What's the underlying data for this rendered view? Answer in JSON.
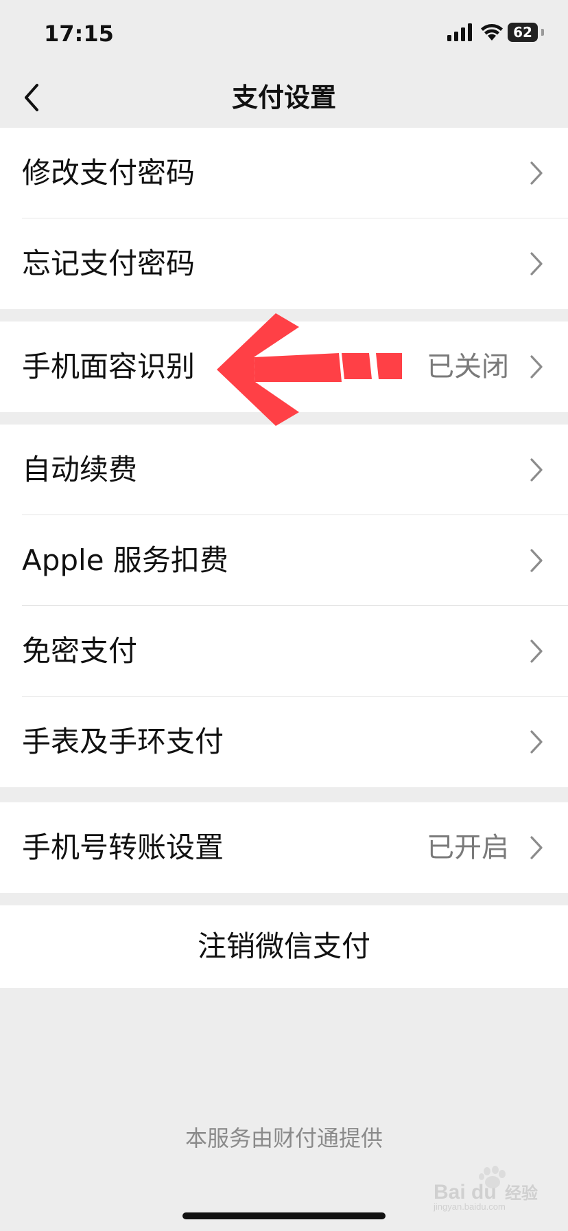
{
  "status_bar": {
    "time": "17:15",
    "battery": "62"
  },
  "nav": {
    "title": "支付设置"
  },
  "groups": [
    {
      "items": [
        {
          "label": "修改支付密码"
        },
        {
          "label": "忘记支付密码"
        }
      ]
    },
    {
      "items": [
        {
          "label": "手机面容识别",
          "value": "已关闭"
        }
      ]
    },
    {
      "items": [
        {
          "label": "自动续费"
        },
        {
          "label": "Apple 服务扣费"
        },
        {
          "label": "免密支付"
        },
        {
          "label": "手表及手环支付"
        }
      ]
    },
    {
      "items": [
        {
          "label": "手机号转账设置",
          "value": "已开启"
        }
      ]
    }
  ],
  "logout": {
    "label": "注销微信支付"
  },
  "footer": {
    "text": "本服务由财付通提供"
  },
  "watermark": {
    "brand": "Bai du",
    "suffix": "经验",
    "domain": "jingyan.baidu.com"
  },
  "colors": {
    "annotation_arrow": "#ff4046",
    "background": "#ededed",
    "value_text": "#7a7a7a"
  }
}
